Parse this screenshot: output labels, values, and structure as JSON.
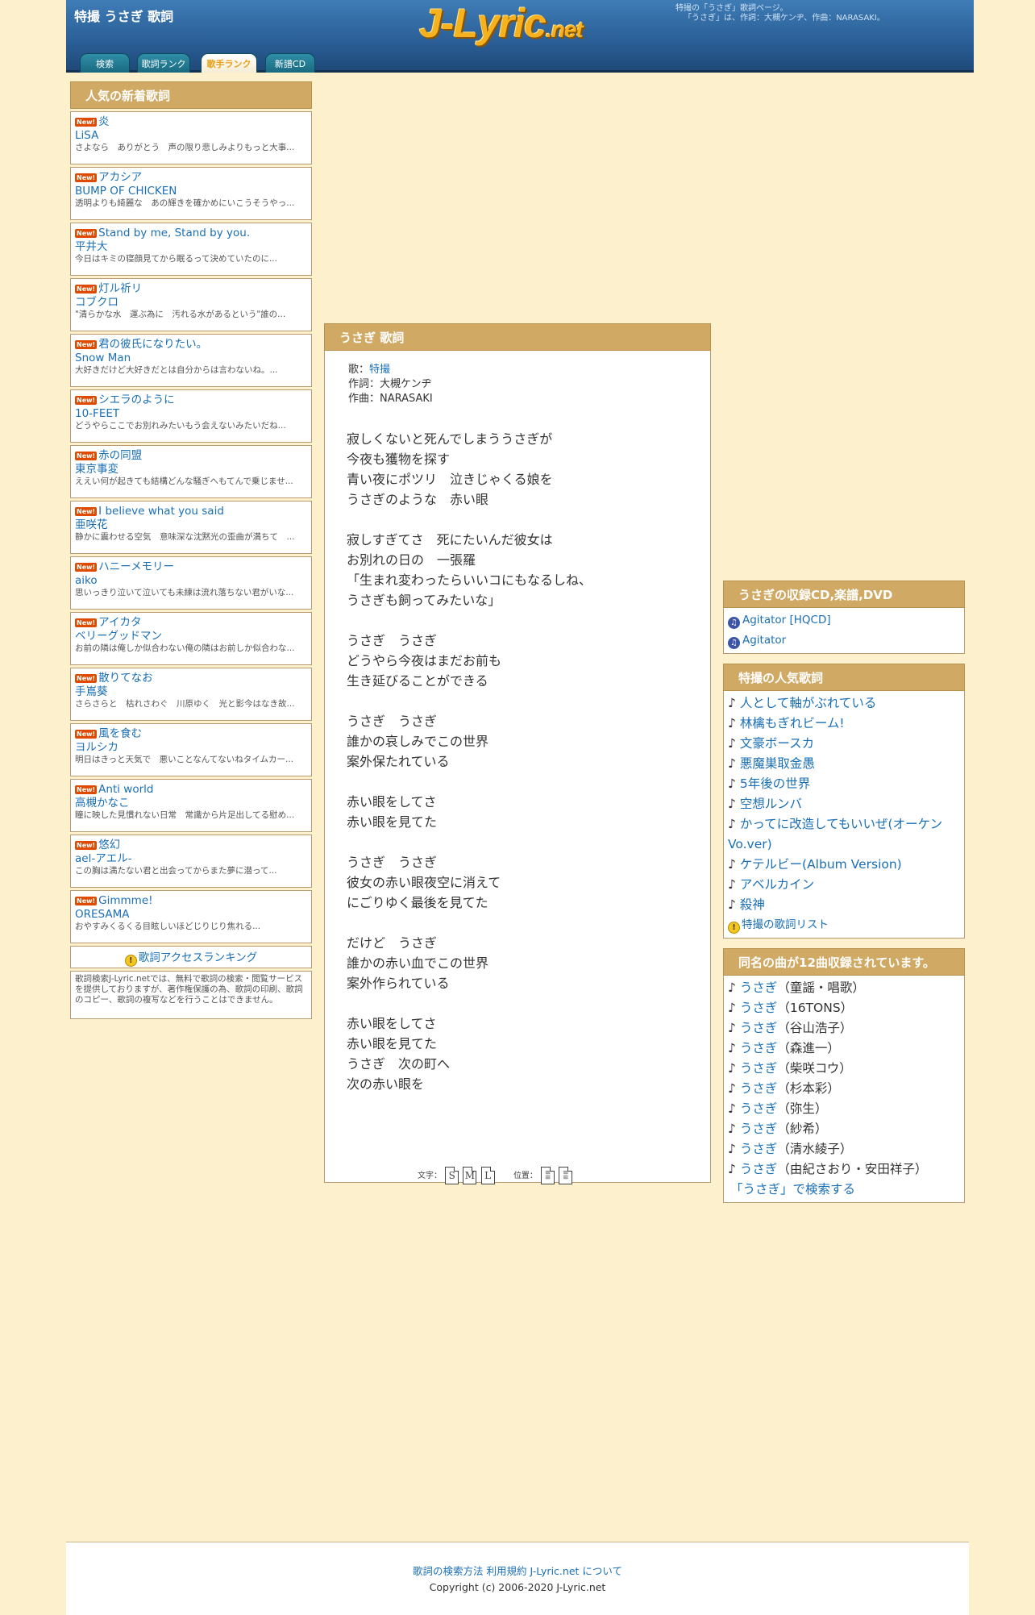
{
  "header": {
    "page_title": "特撮 うさぎ 歌詞",
    "logo_main": "J-Lyric",
    "logo_suffix": ".net",
    "desc_line1": "特撮の「うさぎ」歌詞ページ。",
    "desc_line2": "「うさぎ」は、作詞：大槻ケンヂ、作曲：NARASAKI。",
    "tabs": [
      {
        "label": "検索"
      },
      {
        "label": "歌詞ランク"
      },
      {
        "label": "歌手ランク"
      },
      {
        "label": "新譜CD"
      }
    ]
  },
  "left": {
    "heading": "人気の新着歌詞",
    "new_badge": "New!",
    "items": [
      {
        "title": "炎",
        "artist": "LiSA",
        "snippet": "さよなら　ありがとう　声の限り悲しみよりもっと大事..."
      },
      {
        "title": "アカシア",
        "artist": "BUMP OF CHICKEN",
        "snippet": "透明よりも綺麗な　あの輝きを確かめにいこうそうやっ..."
      },
      {
        "title": "Stand by me, Stand by you.",
        "artist": "平井大",
        "snippet": "今日はキミの寝顔見てから眠るって決めていたのに..."
      },
      {
        "title": "灯ル祈リ",
        "artist": "コブクロ",
        "snippet": "\"清らかな水　運ぶ為に　汚れる水があるという\"誰の..."
      },
      {
        "title": "君の彼氏になりたい。",
        "artist": "Snow Man",
        "snippet": "大好きだけど大好きだとは自分からは言わないね。..."
      },
      {
        "title": "シエラのように",
        "artist": "10-FEET",
        "snippet": "どうやらここでお別れみたいもう会えないみたいだね..."
      },
      {
        "title": "赤の同盟",
        "artist": "東京事変",
        "snippet": "ええい何が起きても結構どんな騒ぎへもてんで乗じませ..."
      },
      {
        "title": "I believe what you said",
        "artist": "亜咲花",
        "snippet": "静かに震わせる空気　意味深な沈黙光の歪曲が満ちて　..."
      },
      {
        "title": "ハニーメモリー",
        "artist": "aiko",
        "snippet": "思いっきり泣いて泣いても未練は流れ落ちない君がいな..."
      },
      {
        "title": "アイカタ",
        "artist": "ベリーグッドマン",
        "snippet": "お前の隣は俺しか似合わない俺の隣はお前しか似合わな..."
      },
      {
        "title": "散りてなお",
        "artist": "手嶌葵",
        "snippet": "さらさらと　枯れさわぐ　川原ゆく　光と影今はなき故..."
      },
      {
        "title": "風を食む",
        "artist": "ヨルシカ",
        "snippet": "明日はきっと天気で　悪いことなんてないねタイムカー..."
      },
      {
        "title": "Anti world",
        "artist": "高槻かなこ",
        "snippet": "瞳に映した見慣れない日常　常識から片足出してる慰め..."
      },
      {
        "title": "悠幻",
        "artist": "ael-アエル-",
        "snippet": "この胸は満たない君と出会ってからまた夢に潜って..."
      },
      {
        "title": "Gimmme!",
        "artist": "ORESAMA",
        "snippet": "おやすみくるくる目眩しいほどじりじり焦れる..."
      }
    ],
    "ranking_link": "歌詞アクセスランキング",
    "notice": "歌詞検索J-Lyric.netでは、無料で歌詞の検索・閲覧サービスを提供しておりますが、著作権保護の為、歌詞の印刷、歌詞のコピー、歌詞の複写などを行うことはできません。"
  },
  "song": {
    "heading": "うさぎ 歌詞",
    "singer_label": "歌：",
    "singer": "特撮",
    "lyricist_line": "作詞：大槻ケンヂ",
    "composer_line": "作曲：NARASAKI",
    "lyrics": "寂しくないと死んでしまううさぎが\n今夜も獲物を探す\n青い夜にポツリ　泣きじゃくる娘を\nうさぎのような　赤い眼\n\n寂しすぎてさ　死にたいんだ彼女は\nお別れの日の　一張羅\n「生まれ変わったらいいコにもなるしね、\nうさぎも飼ってみたいな」\n\nうさぎ　うさぎ\nどうやら今夜はまだお前も\n生き延びることができる\n\nうさぎ　うさぎ\n誰かの哀しみでこの世界\n案外保たれている\n\n赤い眼をしてさ\n赤い眼を見てた\n\nうさぎ　うさぎ\n彼女の赤い眼夜空に消えて\nにごりゆく最後を見てた\n\nだけど　うさぎ\n誰かの赤い血でこの世界\n案外作られている\n\n赤い眼をしてさ\n赤い眼を見てた\nうさぎ　次の町へ\n次の赤い眼を",
    "font_label": "文字：",
    "font_sizes": [
      "S",
      "M",
      "L"
    ],
    "position_label": "位置："
  },
  "right": {
    "cd_heading": "うさぎの収録CD,楽譜,DVD",
    "cds": [
      {
        "title": "Agitator [HQCD]"
      },
      {
        "title": "Agitator"
      }
    ],
    "popular_heading": "特撮の人気歌詞",
    "note": "♪",
    "popular": [
      "人として軸がぶれている",
      "林檎もぎれビーム!",
      "文豪ボースカ",
      "悪魔巣取金愚",
      "5年後の世界",
      "空想ルンバ",
      "かってに改造してもいいぜ(オーケンVo.ver)",
      "ケテルビー(Album Version)",
      "アベルカイン",
      "殺神"
    ],
    "popular_more": "特撮の歌詞リスト",
    "same_heading": "同名の曲が12曲収録されています。",
    "same_title": "うさぎ",
    "same": [
      "（童謡・唱歌）",
      "（16TONS）",
      "（谷山浩子）",
      "（森進一）",
      "（柴咲コウ）",
      "（杉本彩）",
      "（弥生）",
      "（紗希）",
      "（清水綾子）",
      "（由紀さおり・安田祥子）"
    ],
    "search_link": "「うさぎ」で検索する"
  },
  "footer": {
    "links": [
      "歌詞の検索方法",
      "利用規約",
      "J-Lyric.net について"
    ],
    "copyright": "Copyright (c) 2006-2020 J-Lyric.net"
  },
  "colors": {
    "header": "#2a5e96",
    "panel_head": "#d0aa64",
    "background": "#fdf0cc",
    "link": "#1a6fb5",
    "tab_active_text": "#e7a017"
  }
}
